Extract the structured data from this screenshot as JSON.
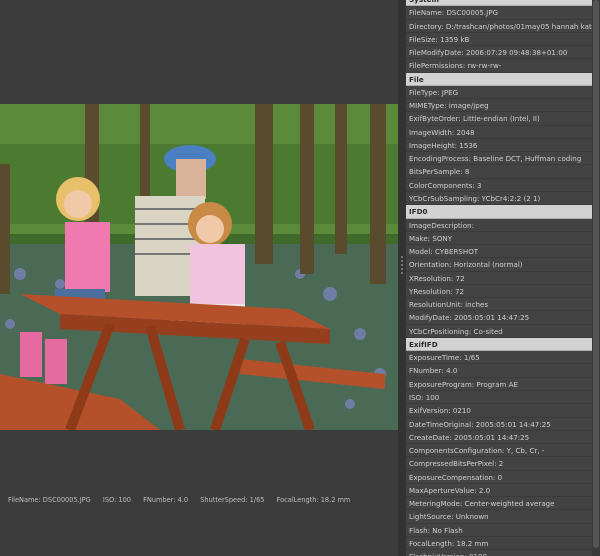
{
  "status": {
    "filename": "FileName: DSC00005.JPG",
    "iso": "ISO: 100",
    "fnumber": "FNumber: 4.0",
    "shutter": "ShutterSpeed: 1/65",
    "focal": "FocalLength: 18.2 mm"
  },
  "metadata": {
    "rows": [
      {
        "type": "header",
        "text": "System"
      },
      {
        "type": "item",
        "text": "FileName: DSC00005.JPG"
      },
      {
        "type": "item",
        "text": "Directory: D:/trashcan/photos/01may05 hannah kati..."
      },
      {
        "type": "item",
        "text": "FileSize: 1359 kB"
      },
      {
        "type": "item",
        "text": "FileModifyDate: 2006:07:29 09:48:38+01:00"
      },
      {
        "type": "item",
        "text": "FilePermissions: rw-rw-rw-"
      },
      {
        "type": "header",
        "text": "File"
      },
      {
        "type": "item",
        "text": "FileType: JPEG"
      },
      {
        "type": "item",
        "text": "MIMEType: image/jpeg"
      },
      {
        "type": "item",
        "text": "ExifByteOrder: Little-endian (Intel, II)"
      },
      {
        "type": "item",
        "text": "ImageWidth: 2048"
      },
      {
        "type": "item",
        "text": "ImageHeight: 1536"
      },
      {
        "type": "item",
        "text": "EncodingProcess: Baseline DCT, Huffman coding"
      },
      {
        "type": "item",
        "text": "BitsPerSample: 8"
      },
      {
        "type": "item",
        "text": "ColorComponents: 3"
      },
      {
        "type": "item",
        "text": "YCbCrSubSampling: YCbCr4:2:2 (2 1)"
      },
      {
        "type": "header",
        "text": "IFD0"
      },
      {
        "type": "item",
        "text": "ImageDescription:"
      },
      {
        "type": "item",
        "text": "Make: SONY"
      },
      {
        "type": "item",
        "text": "Model: CYBERSHOT"
      },
      {
        "type": "item",
        "text": "Orientation: Horizontal (normal)"
      },
      {
        "type": "item",
        "text": "XResolution: 72"
      },
      {
        "type": "item",
        "text": "YResolution: 72"
      },
      {
        "type": "item",
        "text": "ResolutionUnit: inches"
      },
      {
        "type": "item",
        "text": "ModifyDate: 2005:05:01 14:47:25"
      },
      {
        "type": "item",
        "text": "YCbCrPositioning: Co-sited"
      },
      {
        "type": "header",
        "text": "ExifIFD"
      },
      {
        "type": "item",
        "text": "ExposureTime: 1/65"
      },
      {
        "type": "item",
        "text": "FNumber: 4.0"
      },
      {
        "type": "item",
        "text": "ExposureProgram: Program AE"
      },
      {
        "type": "item",
        "text": "ISO: 100"
      },
      {
        "type": "item",
        "text": "ExifVersion: 0210"
      },
      {
        "type": "item",
        "text": "DateTimeOriginal: 2005:05:01 14:47:25"
      },
      {
        "type": "item",
        "text": "CreateDate: 2005:05:01 14:47:25"
      },
      {
        "type": "item",
        "text": "ComponentsConfiguration: Y, Cb, Cr, -"
      },
      {
        "type": "item",
        "text": "CompressedBitsPerPixel: 2"
      },
      {
        "type": "item",
        "text": "ExposureCompensation: 0"
      },
      {
        "type": "item",
        "text": "MaxApertureValue: 2.0"
      },
      {
        "type": "item",
        "text": "MeteringMode: Center-weighted average"
      },
      {
        "type": "item",
        "text": "LightSource: Unknown"
      },
      {
        "type": "item",
        "text": "Flash: No Flash"
      },
      {
        "type": "item",
        "text": "FocalLength: 18.2 mm"
      },
      {
        "type": "item",
        "text": "FlashpixVersion: 0100"
      }
    ]
  },
  "photo_icon": "photo-image"
}
